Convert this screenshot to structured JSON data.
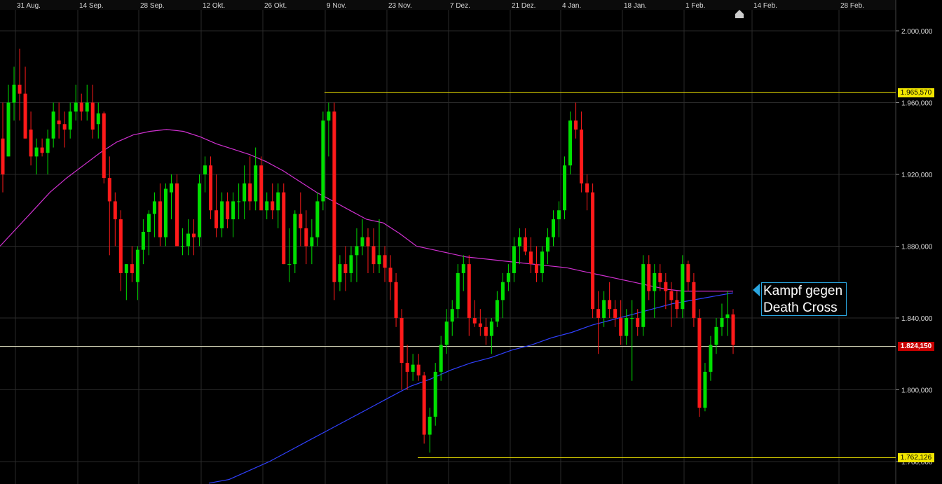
{
  "chart_data": {
    "type": "candlestick",
    "x_ticks": [
      "31 Aug.",
      "14 Sep.",
      "28 Sep.",
      "12 Okt.",
      "26 Okt.",
      "9 Nov.",
      "23 Nov.",
      "7 Dez.",
      "21 Dez.",
      "4 Jan.",
      "18 Jan.",
      "1 Feb.",
      "14 Feb.",
      "28 Feb."
    ],
    "y_ticks": [
      "2.000,000",
      "1.960,000",
      "1.920,000",
      "1.880,000",
      "1.840,000",
      "1.800,000",
      "1.760,000"
    ],
    "ylim": [
      1.75,
      2.01
    ],
    "levels": {
      "high_line": {
        "value": 1.96557,
        "label": "1.965,570",
        "color": "#f2e600"
      },
      "low_line": {
        "value": 1.762126,
        "label": "1.762,126",
        "color": "#f2e600"
      },
      "current": {
        "value": 1.82415,
        "label": "1.824,150",
        "color": "#c80000"
      }
    },
    "colors": {
      "up": "#00e000",
      "down": "#ff1a1a",
      "ma_short": "#d030d0",
      "ma_long": "#3040ff",
      "grid": "#2a2a2a"
    },
    "candles": [
      [
        1.94,
        1.96,
        1.91,
        1.92
      ],
      [
        1.93,
        1.97,
        1.93,
        1.96
      ],
      [
        1.96,
        1.98,
        1.95,
        1.97
      ],
      [
        1.97,
        1.99,
        1.95,
        1.965
      ],
      [
        1.965,
        1.98,
        1.94,
        1.94
      ],
      [
        1.945,
        1.955,
        1.925,
        1.93
      ],
      [
        1.93,
        1.94,
        1.92,
        1.935
      ],
      [
        1.935,
        1.94,
        1.93,
        1.932
      ],
      [
        1.932,
        1.945,
        1.92,
        1.94
      ],
      [
        1.94,
        1.96,
        1.935,
        1.955
      ],
      [
        1.95,
        1.96,
        1.94,
        1.948
      ],
      [
        1.948,
        1.955,
        1.935,
        1.945
      ],
      [
        1.945,
        1.96,
        1.94,
        1.955
      ],
      [
        1.955,
        1.97,
        1.95,
        1.96
      ],
      [
        1.96,
        1.965,
        1.95,
        1.955
      ],
      [
        1.955,
        1.97,
        1.95,
        1.96
      ],
      [
        1.96,
        1.97,
        1.94,
        1.945
      ],
      [
        1.948,
        1.96,
        1.94,
        1.954
      ],
      [
        1.954,
        1.955,
        1.915,
        1.918
      ],
      [
        1.918,
        1.93,
        1.875,
        1.905
      ],
      [
        1.905,
        1.91,
        1.88,
        1.895
      ],
      [
        1.895,
        1.9,
        1.855,
        1.865
      ],
      [
        1.865,
        1.87,
        1.85,
        1.87
      ],
      [
        1.87,
        1.88,
        1.86,
        1.865
      ],
      [
        1.86,
        1.88,
        1.85,
        1.878
      ],
      [
        1.878,
        1.895,
        1.87,
        1.888
      ],
      [
        1.888,
        1.9,
        1.875,
        1.898
      ],
      [
        1.898,
        1.91,
        1.885,
        1.905
      ],
      [
        1.905,
        1.915,
        1.88,
        1.885
      ],
      [
        1.885,
        1.915,
        1.88,
        1.912
      ],
      [
        1.91,
        1.92,
        1.895,
        1.915
      ],
      [
        1.915,
        1.92,
        1.88,
        1.88
      ],
      [
        1.88,
        1.89,
        1.875,
        1.88
      ],
      [
        1.88,
        1.895,
        1.875,
        1.887
      ],
      [
        1.887,
        1.895,
        1.875,
        1.885
      ],
      [
        1.885,
        1.92,
        1.88,
        1.915
      ],
      [
        1.92,
        1.93,
        1.91,
        1.925
      ],
      [
        1.925,
        1.93,
        1.895,
        1.9
      ],
      [
        1.9,
        1.92,
        1.885,
        1.89
      ],
      [
        1.89,
        1.91,
        1.885,
        1.905
      ],
      [
        1.905,
        1.91,
        1.89,
        1.895
      ],
      [
        1.895,
        1.91,
        1.885,
        1.905
      ],
      [
        1.905,
        1.915,
        1.895,
        1.905
      ],
      [
        1.905,
        1.925,
        1.895,
        1.915
      ],
      [
        1.915,
        1.93,
        1.9,
        1.905
      ],
      [
        1.905,
        1.935,
        1.9,
        1.925
      ],
      [
        1.925,
        1.93,
        1.9,
        1.9
      ],
      [
        1.9,
        1.91,
        1.895,
        1.905
      ],
      [
        1.905,
        1.915,
        1.895,
        1.9
      ],
      [
        1.9,
        1.915,
        1.89,
        1.91
      ],
      [
        1.91,
        1.915,
        1.87,
        1.87
      ],
      [
        1.87,
        1.89,
        1.86,
        1.87
      ],
      [
        1.87,
        1.9,
        1.865,
        1.898
      ],
      [
        1.898,
        1.91,
        1.88,
        1.89
      ],
      [
        1.89,
        1.9,
        1.87,
        1.88
      ],
      [
        1.88,
        1.895,
        1.87,
        1.885
      ],
      [
        1.885,
        1.91,
        1.88,
        1.905
      ],
      [
        1.905,
        1.955,
        1.9,
        1.95
      ],
      [
        1.95,
        1.96,
        1.93,
        1.955
      ],
      [
        1.955,
        1.96,
        1.85,
        1.86
      ],
      [
        1.86,
        1.875,
        1.855,
        1.87
      ],
      [
        1.87,
        1.88,
        1.855,
        1.865
      ],
      [
        1.865,
        1.88,
        1.86,
        1.875
      ],
      [
        1.875,
        1.89,
        1.86,
        1.88
      ],
      [
        1.88,
        1.895,
        1.875,
        1.885
      ],
      [
        1.885,
        1.89,
        1.865,
        1.88
      ],
      [
        1.88,
        1.89,
        1.865,
        1.87
      ],
      [
        1.87,
        1.895,
        1.865,
        1.875
      ],
      [
        1.875,
        1.88,
        1.86,
        1.868
      ],
      [
        1.868,
        1.875,
        1.85,
        1.86
      ],
      [
        1.86,
        1.865,
        1.835,
        1.84
      ],
      [
        1.84,
        1.845,
        1.8,
        1.815
      ],
      [
        1.815,
        1.825,
        1.8,
        1.81
      ],
      [
        1.81,
        1.82,
        1.805,
        1.814
      ],
      [
        1.814,
        1.82,
        1.805,
        1.808
      ],
      [
        1.808,
        1.81,
        1.77,
        1.775
      ],
      [
        1.775,
        1.79,
        1.765,
        1.785
      ],
      [
        1.785,
        1.815,
        1.78,
        1.81
      ],
      [
        1.81,
        1.83,
        1.805,
        1.825
      ],
      [
        1.825,
        1.845,
        1.82,
        1.838
      ],
      [
        1.838,
        1.85,
        1.83,
        1.845
      ],
      [
        1.845,
        1.87,
        1.84,
        1.865
      ],
      [
        1.865,
        1.875,
        1.855,
        1.87
      ],
      [
        1.87,
        1.875,
        1.83,
        1.84
      ],
      [
        1.84,
        1.85,
        1.835,
        1.837
      ],
      [
        1.837,
        1.845,
        1.83,
        1.835
      ],
      [
        1.835,
        1.84,
        1.825,
        1.83
      ],
      [
        1.83,
        1.84,
        1.82,
        1.838
      ],
      [
        1.838,
        1.855,
        1.835,
        1.85
      ],
      [
        1.85,
        1.865,
        1.84,
        1.86
      ],
      [
        1.86,
        1.87,
        1.855,
        1.865
      ],
      [
        1.865,
        1.885,
        1.86,
        1.88
      ],
      [
        1.88,
        1.89,
        1.87,
        1.885
      ],
      [
        1.885,
        1.89,
        1.875,
        1.877
      ],
      [
        1.877,
        1.885,
        1.865,
        1.87
      ],
      [
        1.87,
        1.88,
        1.86,
        1.865
      ],
      [
        1.865,
        1.88,
        1.86,
        1.877
      ],
      [
        1.877,
        1.89,
        1.87,
        1.885
      ],
      [
        1.885,
        1.9,
        1.88,
        1.895
      ],
      [
        1.895,
        1.905,
        1.885,
        1.9
      ],
      [
        1.9,
        1.93,
        1.895,
        1.925
      ],
      [
        1.925,
        1.955,
        1.92,
        1.95
      ],
      [
        1.95,
        1.96,
        1.94,
        1.945
      ],
      [
        1.945,
        1.955,
        1.91,
        1.915
      ],
      [
        1.915,
        1.92,
        1.9,
        1.91
      ],
      [
        1.91,
        1.915,
        1.84,
        1.845
      ],
      [
        1.845,
        1.855,
        1.82,
        1.84
      ],
      [
        1.84,
        1.855,
        1.835,
        1.85
      ],
      [
        1.85,
        1.86,
        1.84,
        1.845
      ],
      [
        1.845,
        1.85,
        1.835,
        1.84
      ],
      [
        1.84,
        1.85,
        1.825,
        1.83
      ],
      [
        1.83,
        1.845,
        1.825,
        1.84
      ],
      [
        1.84,
        1.85,
        1.805,
        1.84
      ],
      [
        1.84,
        1.845,
        1.83,
        1.835
      ],
      [
        1.835,
        1.875,
        1.83,
        1.87
      ],
      [
        1.87,
        1.875,
        1.85,
        1.855
      ],
      [
        1.855,
        1.87,
        1.84,
        1.865
      ],
      [
        1.865,
        1.87,
        1.855,
        1.86
      ],
      [
        1.86,
        1.865,
        1.845,
        1.855
      ],
      [
        1.855,
        1.86,
        1.835,
        1.85
      ],
      [
        1.85,
        1.855,
        1.84,
        1.845
      ],
      [
        1.845,
        1.875,
        1.84,
        1.87
      ],
      [
        1.87,
        1.872,
        1.855,
        1.86
      ],
      [
        1.86,
        1.865,
        1.835,
        1.84
      ],
      [
        1.84,
        1.845,
        1.785,
        1.79
      ],
      [
        1.79,
        1.815,
        1.788,
        1.81
      ],
      [
        1.81,
        1.83,
        1.805,
        1.825
      ],
      [
        1.825,
        1.84,
        1.82,
        1.835
      ],
      [
        1.835,
        1.848,
        1.83,
        1.84
      ],
      [
        1.84,
        1.855,
        1.83,
        1.842
      ],
      [
        1.842,
        1.845,
        1.82,
        1.825
      ]
    ],
    "ma_short": [
      1.88,
      1.89,
      1.9,
      1.91,
      1.918,
      1.925,
      1.932,
      1.938,
      1.942,
      1.944,
      1.945,
      1.944,
      1.941,
      1.937,
      1.934,
      1.931,
      1.927,
      1.922,
      1.916,
      1.91,
      1.905,
      1.9,
      1.895,
      1.893,
      1.887,
      1.88,
      1.878,
      1.876,
      1.874,
      1.873,
      1.872,
      1.871,
      1.87,
      1.869,
      1.868,
      1.866,
      1.864,
      1.862,
      1.86,
      1.858,
      1.856,
      1.855,
      1.855,
      1.855,
      1.855
    ],
    "ma_long": [
      1.748,
      1.75,
      1.755,
      1.76,
      1.766,
      1.772,
      1.778,
      1.784,
      1.79,
      1.796,
      1.802,
      1.806,
      1.811,
      1.815,
      1.818,
      1.822,
      1.825,
      1.829,
      1.832,
      1.836,
      1.839,
      1.842,
      1.845,
      1.848,
      1.85,
      1.852,
      1.854
    ],
    "annotation": {
      "line1": "Kampf gegen",
      "line2": "Death Cross"
    }
  }
}
